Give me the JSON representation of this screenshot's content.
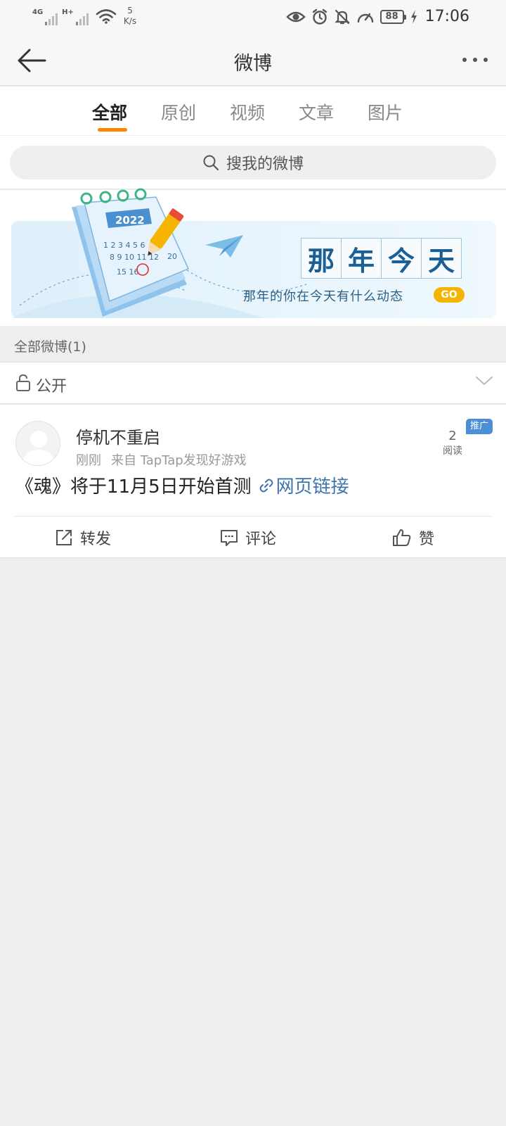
{
  "status_bar": {
    "signal1_label": "4G",
    "signal2_label": "H+",
    "speed_value": "5",
    "speed_unit": "K/s",
    "battery": "88",
    "time": "17:06"
  },
  "header": {
    "title": "微博"
  },
  "tabs": [
    {
      "label": "全部",
      "active": true
    },
    {
      "label": "原创",
      "active": false
    },
    {
      "label": "视频",
      "active": false
    },
    {
      "label": "文章",
      "active": false
    },
    {
      "label": "图片",
      "active": false
    }
  ],
  "search": {
    "placeholder": "搜我的微博"
  },
  "banner": {
    "calendar_year": "2022",
    "title_chars": [
      "那",
      "年",
      "今",
      "天"
    ],
    "subtitle": "那年的你在今天有什么动态",
    "go_label": "GO"
  },
  "section": {
    "label": "全部微博(1)"
  },
  "filter": {
    "label": "公开"
  },
  "post": {
    "username": "停机不重启",
    "time": "刚刚",
    "source": "来自 TapTap发现好游戏",
    "read_count": "2",
    "read_label": "阅读",
    "promo_badge": "推广",
    "text": "《魂》将于11月5日开始首测",
    "link_text": "网页链接",
    "actions": {
      "repost": "转发",
      "comment": "评论",
      "like": "赞"
    }
  }
}
